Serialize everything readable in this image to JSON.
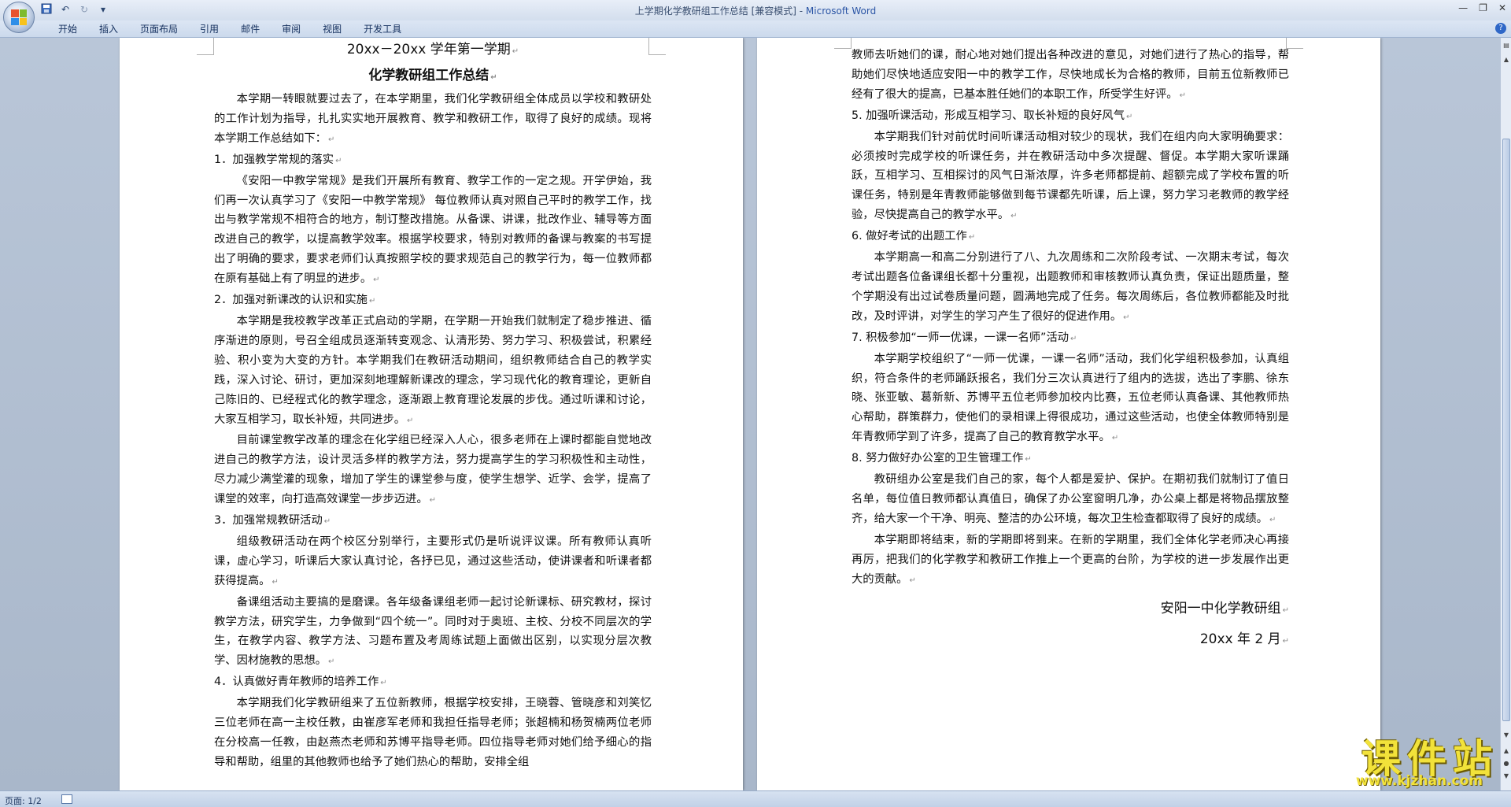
{
  "titlebar": {
    "doc_title": "上学期化学教研组工作总结 [兼容模式] - ",
    "app_name": "Microsoft Word",
    "qat_icons": [
      "save-icon",
      "undo-icon",
      "redo-icon",
      "customize-icon"
    ],
    "controls": [
      "minimize-icon",
      "restore-icon",
      "close-icon"
    ]
  },
  "ribbon": {
    "tabs": [
      "开始",
      "插入",
      "页面布局",
      "引用",
      "邮件",
      "审阅",
      "视图",
      "开发工具"
    ]
  },
  "page1": {
    "title1": "20xx－20xx 学年第一学期",
    "title2": "化学教研组工作总结",
    "p_intro": "本学期一转眼就要过去了，在本学期里，我们化学教研组全体成员以学校和教研处的工作计划为指导，扎扎实实地开展教育、教学和教研工作，取得了良好的成绩。现将本学期工作总结如下：",
    "h1": "1．加强教学常规的落实",
    "p1": "《安阳一中教学常规》是我们开展所有教育、教学工作的一定之规。开学伊始，我们再一次认真学习了《安阳一中教学常规》 每位教师认真对照自己平时的教学工作，找出与教学常规不相符合的地方，制订整改措施。从备课、讲课，批改作业、辅导等方面改进自己的教学，以提高教学效率。根据学校要求，特别对教师的备课与教案的书写提出了明确的要求，要求老师们认真按照学校的要求规范自己的教学行为，每一位教师都在原有基础上有了明显的进步。",
    "h2": "2．加强对新课改的认识和实施",
    "p2a": "本学期是我校教学改革正式启动的学期，在学期一开始我们就制定了稳步推进、循序渐进的原则，号召全组成员逐渐转变观念、认清形势、努力学习、积极尝试，积累经验、积小变为大变的方针。本学期我们在教研活动期间，组织教师结合自己的教学实践，深入讨论、研讨，更加深刻地理解新课改的理念，学习现代化的教育理论，更新自己陈旧的、已经程式化的教学理念，逐渐跟上教育理论发展的步伐。通过听课和讨论，大家互相学习，取长补短，共同进步。",
    "p2b": "目前课堂教学改革的理念在化学组已经深入人心，很多老师在上课时都能自觉地改进自己的教学方法，设计灵活多样的教学方法，努力提高学生的学习积极性和主动性，尽力减少满堂灌的现象，增加了学生的课堂参与度，使学生想学、近学、会学，提高了课堂的效率，向打造高效课堂一步步迈进。",
    "h3": "3．加强常规教研活动",
    "p3a": "组级教研活动在两个校区分别举行，主要形式仍是听说评议课。所有教师认真听课，虚心学习，听课后大家认真讨论，各抒已见，通过这些活动，使讲课者和听课者都获得提高。",
    "p3b": "备课组活动主要搞的是磨课。各年级备课组老师一起讨论新课标、研究教材，探讨教学方法，研究学生，力争做到“四个统一”。同时对于奥班、主校、分校不同层次的学生，在教学内容、教学方法、习题布置及考周练试题上面做出区别，以实现分层次教学、因材施教的思想。",
    "h4": "4．认真做好青年教师的培养工作",
    "p4": "本学期我们化学教研组来了五位新教师，根据学校安排，王晓蓉、管晓彦和刘笑忆三位老师在高一主校任教，由崔彦军老师和我担任指导老师；张超楠和杨贺楠两位老师在分校高一任教，由赵燕杰老师和苏博平指导老师。四位指导老师对她们给予细心的指导和帮助，组里的其他教师也给予了她们热心的帮助，安排全组"
  },
  "page2": {
    "p4cont": "教师去听她们的课，耐心地对她们提出各种改进的意见，对她们进行了热心的指导，帮助她们尽快地适应安阳一中的教学工作，尽快地成长为合格的教师，目前五位新教师已经有了很大的提高，已基本胜任她们的本职工作，所受学生好评。",
    "h5": "5. 加强听课活动，形成互相学习、取长补短的良好风气",
    "p5": "本学期我们针对前优时间听课活动相对较少的现状，我们在组内向大家明确要求：必须按时完成学校的听课任务，并在教研活动中多次提醒、督促。本学期大家听课踊跃，互相学习、互相探讨的风气日渐浓厚，许多老师都提前、超额完成了学校布置的听课任务，特别是年青教师能够做到每节课都先听课，后上课，努力学习老教师的教学经验，尽快提高自己的教学水平。",
    "h6": "6. 做好考试的出题工作",
    "p6": "本学期高一和高二分别进行了八、九次周练和二次阶段考试、一次期末考试，每次考试出题各位备课组长都十分重视，出题教师和审核教师认真负责，保证出题质量，整个学期没有出过试卷质量问题，圆满地完成了任务。每次周练后，各位教师都能及时批改，及时评讲，对学生的学习产生了很好的促进作用。",
    "h7": "7. 积极参加“一师一优课，一课一名师”活动",
    "p7": "本学期学校组织了“一师一优课，一课一名师”活动，我们化学组积极参加，认真组织，符合条件的老师踊跃报名，我们分三次认真进行了组内的选拔，选出了李鹏、徐东晓、张亚敏、葛新新、苏博平五位老师参加校内比赛，五位老师认真备课、其他教师热心帮助，群策群力，使他们的录相课上得很成功，通过这些活动，也使全体教师特别是年青教师学到了许多，提高了自己的教育教学水平。",
    "h8": "8. 努力做好办公室的卫生管理工作",
    "p8": "教研组办公室是我们自己的家，每个人都是爱护、保护。在期初我们就制订了值日名单，每位值日教师都认真值日，确保了办公室窗明几净，办公桌上都是将物品摆放整齐，给大家一个干净、明亮、整洁的办公环境，每次卫生检查都取得了良好的成绩。",
    "p9": "本学期即将结束，新的学期即将到来。在新的学期里，我们全体化学老师决心再接再厉，把我们的化学教学和教研工作推上一个更高的台阶，为学校的进一步发展作出更大的贡献。",
    "sign1": "安阳一中化学教研组",
    "sign2": "20xx 年 2 月"
  },
  "statusbar": {
    "page_info": "页面: 1/2"
  },
  "watermark": {
    "main": "课件站",
    "url": "www.kjzhan.com"
  },
  "colors": {
    "accent": "#2b55a5",
    "workspace": "#a9b7ca",
    "watermark": "#f2e23a"
  }
}
